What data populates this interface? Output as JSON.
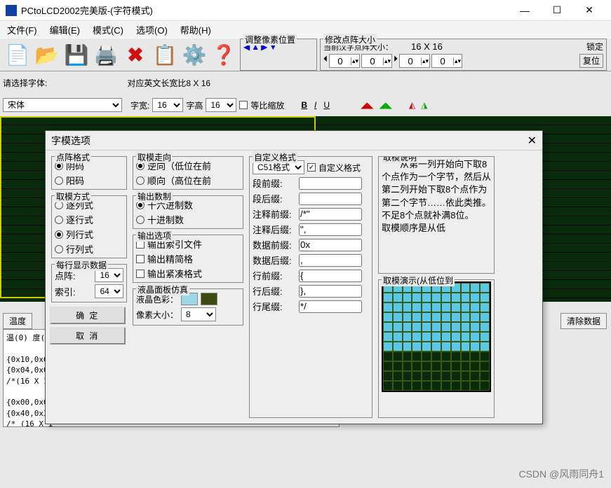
{
  "window": {
    "title": "PCtoLCD2002完美版-(字符模式)",
    "min": "—",
    "max": "☐",
    "close": "✕"
  },
  "menu": {
    "file": "文件(F)",
    "edit": "编辑(E)",
    "mode": "模式(C)",
    "option": "选项(O)",
    "help": "帮助(H)"
  },
  "toolbar": {
    "pixel_adj_title": "调整像素位置",
    "matrix_title": "修改点阵大小",
    "cur_size_label": "当前汉字点阵大小：",
    "cur_size_value": "16 X 16",
    "lock": "锁定",
    "reset": "复位"
  },
  "fontrow": {
    "select_font": "请选择字体:",
    "font_name": "宋体",
    "en_ratio": "对应英文长宽比8 X 16",
    "fw_label": "字宽:",
    "fw_val": "16",
    "fh_label": "字高",
    "fh_val": "16",
    "eq_scale": "等比缩放",
    "bold": "B",
    "italic": "I",
    "underline": "U"
  },
  "sidebar": {
    "temp_label": "温度",
    "clear_data": "清除数据"
  },
  "data_output": "温(0) 度(\n\n{0x10,0x6\n{0x04,0x04\n/*(16 X 1\n\n{0x00,0x0\n{0x40,0x30\n/* (16 X 1",
  "dialog": {
    "title": "字模选项",
    "close": "✕",
    "grp_format": "点阵格式",
    "opt_neg": "阴码",
    "opt_pos": "阳码",
    "grp_method": "取模方式",
    "m1": "逐列式",
    "m2": "逐行式",
    "m3": "列行式",
    "m4": "行列式",
    "grp_line": "每行显示数据",
    "dot_label": "点阵:",
    "dot_val": "16",
    "idx_label": "索引:",
    "idx_val": "64",
    "ok": "确    定",
    "cancel": "取  消",
    "grp_direction": "取模走向",
    "d1": "逆向（低位在前",
    "d2": "顺向（高位在前",
    "grp_radix": "输出数制",
    "r1": "十六进制数",
    "r2": "十进制数",
    "grp_out": "输出选项",
    "o1": "输出索引文件",
    "o2": "输出精简格",
    "o3": "输出紧凑格式",
    "grp_lcd": "液晶面板仿真",
    "lcd_color": "液晶色彩：",
    "px_size_label": "像素大小：",
    "px_size_val": "8",
    "grp_custom": "自定义格式",
    "custom_fmt": "C51格式",
    "custom_chk": "自定义格式",
    "f_pre": "段前缀:",
    "f_suf": "段后缀:",
    "c_pre": "注释前缀:",
    "c_pre_v": "/*\"",
    "c_suf": "注释后缀:",
    "c_suf_v": "\",",
    "d_pre": "数据前缀:",
    "d_pre_v": "0x",
    "d_suf": "数据后缀:",
    "d_suf_v": ",",
    "l_pre": "行前缀:",
    "l_pre_v": "{",
    "l_suf": "行后缀:",
    "l_suf_v": "},",
    "l_tail": "行尾缀:",
    "l_tail_v": "*/",
    "grp_desc": "取模说明",
    "desc_text": "从第一列开始向下取8个点作为一个字节，然后从第二列开始下取8个点作为第二个字节……依此类推。不足8个点就补满8位。\n取模顺序是从低",
    "grp_demo": "取模演示(从低位到"
  },
  "watermark": "CSDN @风雨同舟1"
}
